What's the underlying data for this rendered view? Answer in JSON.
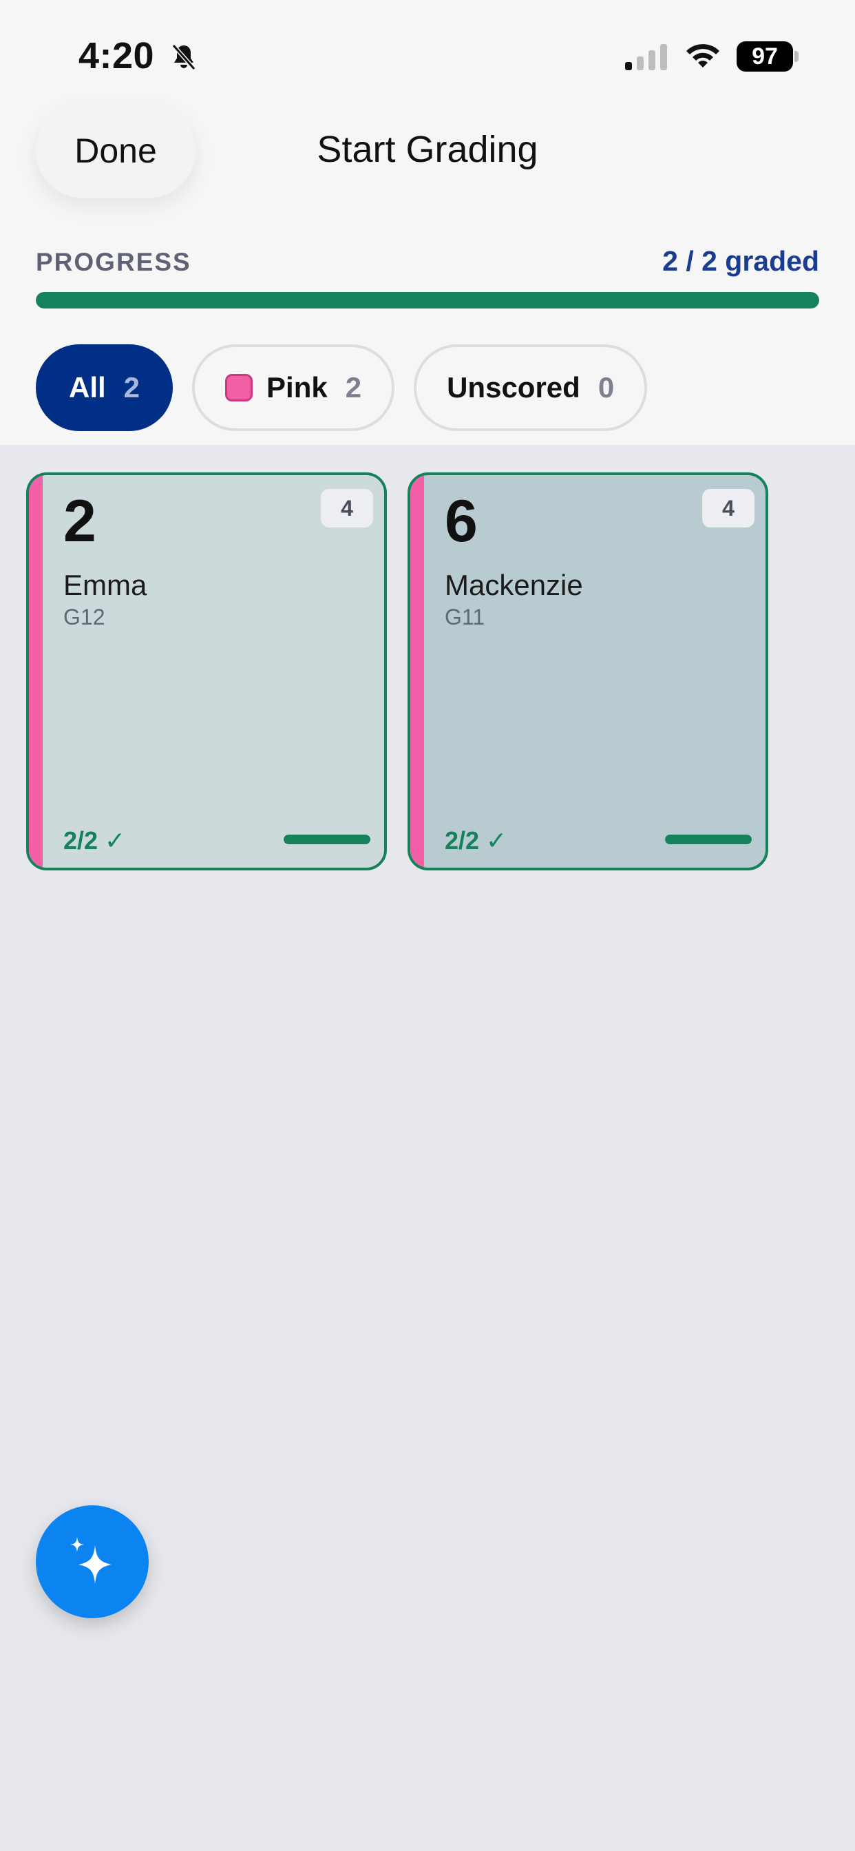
{
  "status_bar": {
    "time": "4:20",
    "battery": "97",
    "icons": [
      "bell-slash-icon",
      "cellular-signal-icon",
      "wifi-icon",
      "battery-icon"
    ]
  },
  "nav": {
    "done_label": "Done",
    "title": "Start Grading"
  },
  "progress": {
    "label": "PROGRESS",
    "count_text": "2 / 2 graded",
    "fraction": 1.0,
    "color": "#14835c"
  },
  "filters": {
    "chips": [
      {
        "label": "All",
        "count": "2",
        "selected": true
      },
      {
        "label": "Pink",
        "count": "2",
        "selected": false,
        "swatch_color": "#f35fa6"
      },
      {
        "label": "Unscored",
        "count": "0",
        "selected": false
      }
    ]
  },
  "cards": [
    {
      "number": "2",
      "name": "Emma",
      "grade": "G12",
      "badge": "4",
      "score": "2/2",
      "check": "✓",
      "completion": 1.0,
      "background": "#cddadb",
      "accent": "#f55fa7"
    },
    {
      "number": "6",
      "name": "Mackenzie",
      "grade": "G11",
      "badge": "4",
      "score": "2/2",
      "check": "✓",
      "completion": 1.0,
      "background": "#b7cbd1",
      "accent": "#f55fa7"
    }
  ],
  "fab": {
    "icon": "sparkles-icon",
    "color": "#0b84f2"
  },
  "colors": {
    "accent_navy": "#012f86",
    "success_green": "#15825b",
    "pink": "#f55fa7"
  }
}
